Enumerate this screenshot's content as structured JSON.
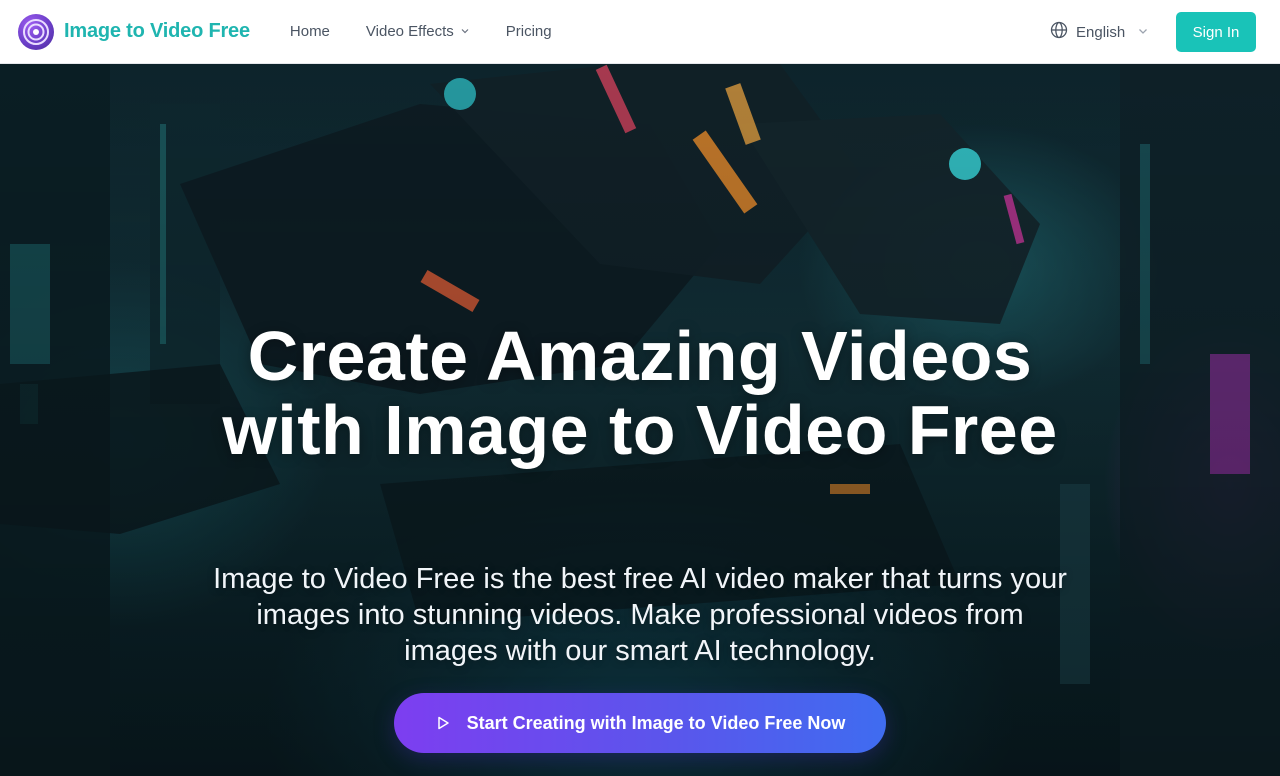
{
  "header": {
    "brand": "Image to Video Free",
    "nav": [
      {
        "label": "Home"
      },
      {
        "label": "Video Effects"
      },
      {
        "label": "Pricing"
      }
    ],
    "language": "English",
    "sign_in": "Sign In"
  },
  "hero": {
    "title": "Create Amazing Videos with Image to Video Free",
    "subtitle": "Image to Video Free is the best free AI video maker that turns your images into stunning videos. Make professional videos from images with our smart AI technology.",
    "cta": "Start Creating with Image to Video Free Now"
  },
  "icons": {
    "logo": "concentric-circle-logo",
    "nav_dropdown": "chevron-down-icon",
    "language": "globe-icon",
    "language_dropdown": "chevron-down-icon",
    "cta": "play-icon"
  },
  "colors": {
    "brand": "#1fb5b0",
    "sign_in_bg": "#19c3b8",
    "cta_gradient_start": "#7d3ef0",
    "cta_gradient_end": "#3f6cf0"
  }
}
